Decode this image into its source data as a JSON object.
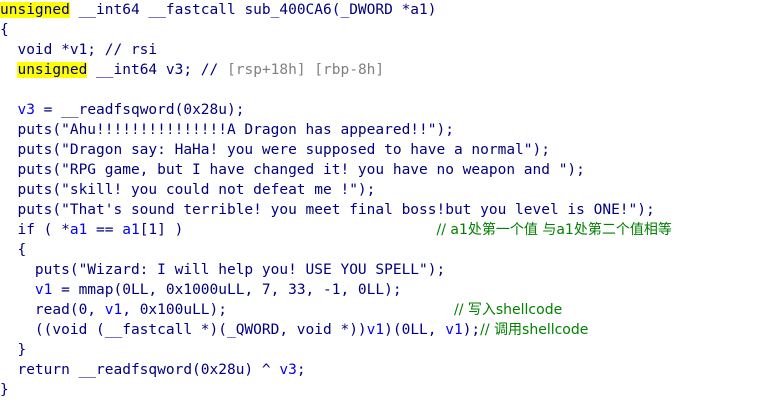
{
  "code": {
    "header": {
      "kw": "unsigned",
      "rest": " __int64 __fastcall sub_400CA6(_DWORD *a1)"
    },
    "open_brace": "{",
    "decl1": {
      "text": "  void *v1; // rsi"
    },
    "decl2": {
      "indent": "  ",
      "kw": "unsigned",
      "rest": " __int64 v3; // ",
      "comment": "[rsp+18h] [rbp-8h]"
    },
    "blank": "",
    "l_v3": {
      "pre": "  ",
      "v": "v3",
      "post": " = __readfsqword(0x28u);"
    },
    "puts1": "  puts(\"Ahu!!!!!!!!!!!!!!!A Dragon has appeared!!\");",
    "puts2": "  puts(\"Dragon say: HaHa! you were supposed to have a normal\");",
    "puts3": "  puts(\"RPG game, but I have changed it! you have no weapon and \");",
    "puts4": "  puts(\"skill! you could not defeat me !\");",
    "puts5": "  puts(\"That's sound terrible! you meet final boss!but you level is ONE!\");",
    "if_line": {
      "pre": "  if ( *",
      "a": "a1",
      "mid": " == ",
      "a2": "a1",
      "post": "[1] )",
      "pad": "                             ",
      "comment": "// a1处第一个值 与a1处第二个值相等"
    },
    "inner_open": "  {",
    "puts6": "    puts(\"Wizard: I will help you! USE YOU SPELL\");",
    "mmap_line": {
      "pre": "    ",
      "v": "v1",
      "post": " = mmap(0LL, 0x1000uLL, 7, 33, -1, 0LL);"
    },
    "read_line": {
      "pre": "    read(0, ",
      "v": "v1",
      "post": ", 0x100uLL);",
      "pad": "                          ",
      "comment": "// 写入shellcode"
    },
    "call_line": {
      "pre": "    ((void (__fastcall *)(_QWORD, void *))",
      "v": "v1",
      "mid": ")(0LL, ",
      "v2": "v1",
      "post": ");",
      "comment": "// 调用shellcode"
    },
    "inner_close": "  }",
    "ret_line": {
      "pre": "  return __readfsqword(0x28u) ^ ",
      "v": "v3",
      "post": ";"
    },
    "close_brace": "}"
  }
}
